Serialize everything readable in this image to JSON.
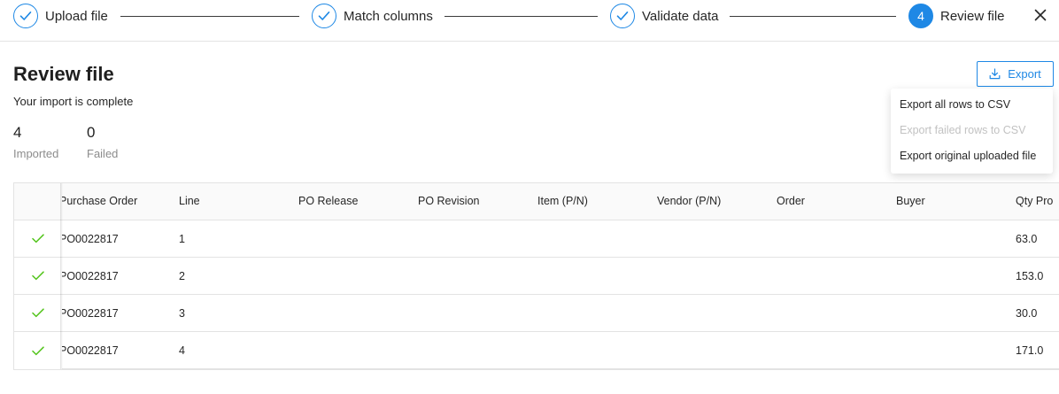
{
  "stepper": {
    "steps": [
      {
        "label": "Upload file",
        "state": "done"
      },
      {
        "label": "Match columns",
        "state": "done"
      },
      {
        "label": "Validate data",
        "state": "done"
      },
      {
        "label": "Review file",
        "state": "active",
        "number": "4"
      }
    ],
    "close_icon": "close-icon"
  },
  "header": {
    "title": "Review file",
    "subtitle": "Your import is complete",
    "export_label": "Export"
  },
  "stats": {
    "imported": {
      "value": "4",
      "label": "Imported"
    },
    "failed": {
      "value": "0",
      "label": "Failed"
    }
  },
  "export_menu": {
    "items": [
      {
        "label": "Export all rows to CSV",
        "disabled": false
      },
      {
        "label": "Export failed rows to CSV",
        "disabled": true
      },
      {
        "label": "Export original uploaded file",
        "disabled": false
      }
    ]
  },
  "table": {
    "columns": [
      "Purchase Order",
      "Line",
      "PO Release",
      "PO Revision",
      "Item (P/N)",
      "Vendor (P/N)",
      "Order",
      "Buyer",
      "Qty Pro"
    ],
    "rows": [
      {
        "po": "PO0022817",
        "line": "1",
        "qty": "63.0"
      },
      {
        "po": "PO0022817",
        "line": "2",
        "qty": "153.0"
      },
      {
        "po": "PO0022817",
        "line": "3",
        "qty": "30.0"
      },
      {
        "po": "PO0022817",
        "line": "4",
        "qty": "171.0"
      }
    ]
  },
  "colors": {
    "accent": "#1e88e5",
    "success": "#52c41a"
  }
}
